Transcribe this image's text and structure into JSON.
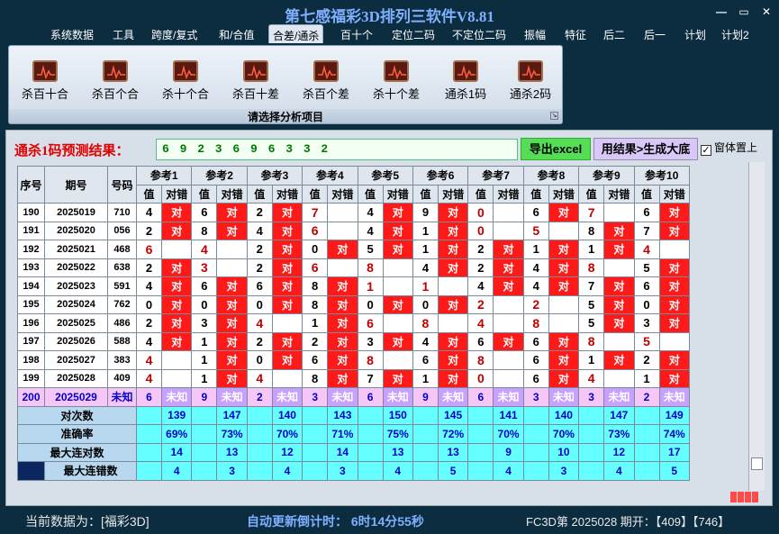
{
  "app": {
    "title": "第七感福彩3D排列三软件V8.81"
  },
  "window": {
    "minimize": "—",
    "restore": "▭",
    "close": "✕"
  },
  "menu": [
    "系统数据",
    "工具",
    "跨度/复式",
    "和/合值",
    "合差/通杀",
    "百十个",
    "定位二码",
    "不定位二码",
    "振幅",
    "特征",
    "后二",
    "后一",
    "计划",
    "计划2"
  ],
  "menu_active": 4,
  "ribbon": {
    "buttons": [
      "杀百十合",
      "杀百个合",
      "杀十个合",
      "杀百十差",
      "杀百个差",
      "杀十个差",
      "通杀1码",
      "通杀2码"
    ],
    "caption": "请选择分析项目",
    "icon": "chart-icon"
  },
  "prediction": {
    "label": "通杀1码预测结果：",
    "value": "6 9 2 3 6 9 6 3 3 2",
    "export_button": "导出excel",
    "generate_button": "用结果>生成大底",
    "window_top_label": "窗体置上",
    "window_top_checked": "✓"
  },
  "table": {
    "headers": {
      "seq": "序号",
      "period": "期号",
      "number": "号码",
      "value": "值",
      "result": "对错"
    },
    "refs": [
      "参考1",
      "参考2",
      "参考3",
      "参考4",
      "参考5",
      "参考6",
      "参考7",
      "参考8",
      "参考9",
      "参考10"
    ],
    "rows": [
      {
        "seq": "190",
        "period": "2025019",
        "number": "710",
        "vals": [
          "4",
          "6",
          "2",
          "7",
          "4",
          "9",
          "0",
          "6",
          "7",
          "6"
        ],
        "hits": [
          1,
          1,
          1,
          0,
          1,
          1,
          0,
          1,
          0,
          1
        ],
        "red": [
          0,
          0,
          0,
          1,
          0,
          0,
          1,
          0,
          1,
          0
        ]
      },
      {
        "seq": "191",
        "period": "2025020",
        "number": "056",
        "vals": [
          "2",
          "8",
          "4",
          "6",
          "4",
          "1",
          "0",
          "5",
          "8",
          "7"
        ],
        "hits": [
          1,
          1,
          1,
          0,
          1,
          1,
          0,
          0,
          1,
          1
        ],
        "red": [
          0,
          0,
          0,
          1,
          0,
          0,
          1,
          1,
          0,
          0
        ]
      },
      {
        "seq": "192",
        "period": "2025021",
        "number": "468",
        "vals": [
          "6",
          "4",
          "2",
          "0",
          "5",
          "1",
          "2",
          "1",
          "1",
          "4"
        ],
        "hits": [
          0,
          0,
          1,
          1,
          1,
          1,
          1,
          1,
          1,
          0
        ],
        "red": [
          1,
          1,
          0,
          0,
          0,
          0,
          0,
          0,
          0,
          1
        ]
      },
      {
        "seq": "193",
        "period": "2025022",
        "number": "638",
        "vals": [
          "2",
          "3",
          "2",
          "6",
          "8",
          "4",
          "2",
          "4",
          "8",
          "5"
        ],
        "hits": [
          1,
          0,
          1,
          0,
          0,
          1,
          1,
          1,
          0,
          1
        ],
        "red": [
          0,
          1,
          0,
          1,
          1,
          0,
          0,
          0,
          1,
          0
        ]
      },
      {
        "seq": "194",
        "period": "2025023",
        "number": "591",
        "vals": [
          "4",
          "6",
          "6",
          "8",
          "1",
          "1",
          "4",
          "4",
          "7",
          "6"
        ],
        "hits": [
          1,
          1,
          1,
          1,
          0,
          0,
          1,
          1,
          1,
          1
        ],
        "red": [
          0,
          0,
          0,
          0,
          1,
          1,
          0,
          0,
          0,
          0
        ]
      },
      {
        "seq": "195",
        "period": "2025024",
        "number": "762",
        "vals": [
          "0",
          "0",
          "0",
          "8",
          "0",
          "0",
          "2",
          "2",
          "5",
          "0"
        ],
        "hits": [
          1,
          1,
          1,
          1,
          1,
          1,
          0,
          0,
          1,
          1
        ],
        "red": [
          0,
          0,
          0,
          0,
          0,
          0,
          1,
          1,
          0,
          0
        ]
      },
      {
        "seq": "196",
        "period": "2025025",
        "number": "486",
        "vals": [
          "2",
          "3",
          "4",
          "1",
          "6",
          "8",
          "4",
          "8",
          "5",
          "3"
        ],
        "hits": [
          1,
          1,
          0,
          1,
          0,
          0,
          0,
          0,
          1,
          1
        ],
        "red": [
          0,
          0,
          1,
          0,
          1,
          1,
          1,
          1,
          0,
          0
        ]
      },
      {
        "seq": "197",
        "period": "2025026",
        "number": "588",
        "vals": [
          "4",
          "1",
          "2",
          "2",
          "3",
          "4",
          "6",
          "6",
          "8",
          "5"
        ],
        "hits": [
          1,
          1,
          1,
          1,
          1,
          1,
          1,
          1,
          0,
          0
        ],
        "red": [
          0,
          0,
          0,
          0,
          0,
          0,
          0,
          0,
          1,
          1
        ]
      },
      {
        "seq": "198",
        "period": "2025027",
        "number": "383",
        "vals": [
          "4",
          "1",
          "0",
          "6",
          "8",
          "6",
          "8",
          "6",
          "1",
          "2"
        ],
        "hits": [
          0,
          1,
          1,
          1,
          0,
          1,
          0,
          1,
          1,
          1
        ],
        "red": [
          1,
          0,
          0,
          0,
          1,
          0,
          1,
          0,
          0,
          0
        ]
      },
      {
        "seq": "199",
        "period": "2025028",
        "number": "409",
        "vals": [
          "4",
          "1",
          "4",
          "8",
          "7",
          "1",
          "0",
          "6",
          "4",
          "1"
        ],
        "hits": [
          0,
          1,
          0,
          1,
          1,
          1,
          0,
          1,
          0,
          1
        ],
        "red": [
          1,
          0,
          1,
          0,
          0,
          0,
          1,
          0,
          1,
          0
        ]
      }
    ],
    "hit_text": "对",
    "future": {
      "seq": "200",
      "period": "2025029",
      "number": "未知",
      "vals": [
        "6",
        "9",
        "2",
        "3",
        "6",
        "9",
        "6",
        "3",
        "3",
        "2"
      ],
      "result": "未知"
    },
    "stats": [
      {
        "label": "对次数",
        "vals": [
          "139",
          "147",
          "140",
          "143",
          "150",
          "145",
          "141",
          "140",
          "147",
          "149"
        ]
      },
      {
        "label": "准确率",
        "vals": [
          "69%",
          "73%",
          "70%",
          "71%",
          "75%",
          "72%",
          "70%",
          "70%",
          "73%",
          "74%"
        ]
      },
      {
        "label": "最大连对数",
        "vals": [
          "14",
          "13",
          "12",
          "14",
          "13",
          "13",
          "9",
          "10",
          "12",
          "17"
        ]
      },
      {
        "label": "最大连错数",
        "vals": [
          "4",
          "3",
          "4",
          "3",
          "4",
          "5",
          "4",
          "3",
          "4",
          "5"
        ]
      }
    ]
  },
  "status": {
    "left": "当前数据为：[福彩3D]",
    "countdown": "自动更新倒计时：  6时14分55秒",
    "right": "FC3D第 2025028 期开：【409】【746】"
  }
}
